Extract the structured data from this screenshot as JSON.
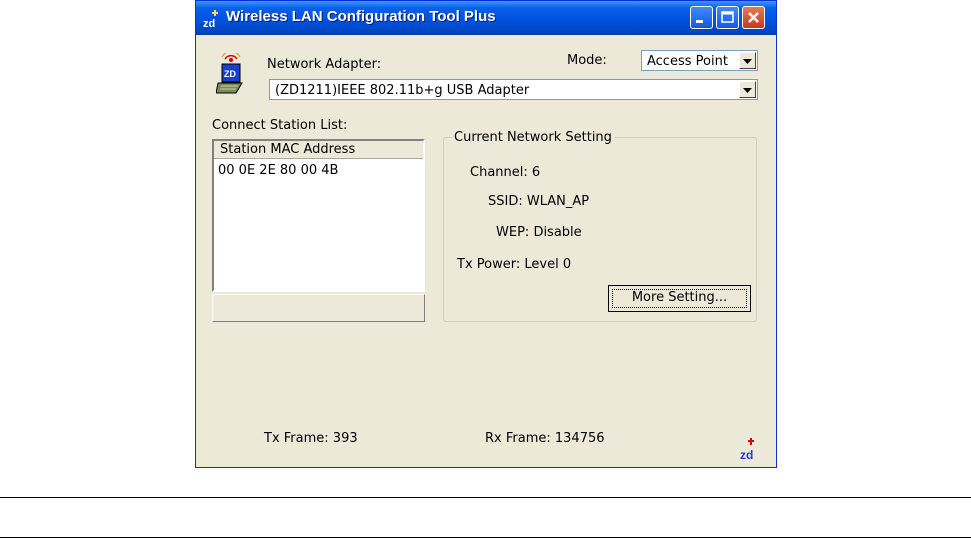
{
  "window": {
    "title": "Wireless LAN Configuration Tool Plus",
    "icons": {
      "app": "zd-logo-icon",
      "minimize": "minimize-icon",
      "maximize": "maximize-icon",
      "close": "close-icon"
    }
  },
  "adapter": {
    "label": "Network Adapter:",
    "icon": "wireless-adapter-icon",
    "selected": "(ZD1211)IEEE 802.11b+g USB Adapter"
  },
  "mode": {
    "label": "Mode:",
    "selected": "Access Point"
  },
  "station_list": {
    "label": "Connect Station List:",
    "column_header": "Station MAC Address",
    "rows": [
      "00 0E 2E 80 00 4B"
    ]
  },
  "network_setting": {
    "title": "Current Network Setting",
    "channel_label": "Channel:",
    "channel_value": "6",
    "ssid_label": "SSID:",
    "ssid_value": "WLAN_AP",
    "wep_label": "WEP:",
    "wep_value": "Disable",
    "txpower_label": "Tx Power:",
    "txpower_value": "Level 0",
    "more_button": "More Setting..."
  },
  "footer": {
    "tx_label": "Tx Frame:",
    "tx_value": "393",
    "rx_label": "Rx Frame:",
    "rx_value": "134756",
    "icon": "zd-tray-icon"
  },
  "colors": {
    "titlebar": "#0054e3",
    "window_bg": "#ece9d8",
    "close_button": "#c43b1c"
  }
}
